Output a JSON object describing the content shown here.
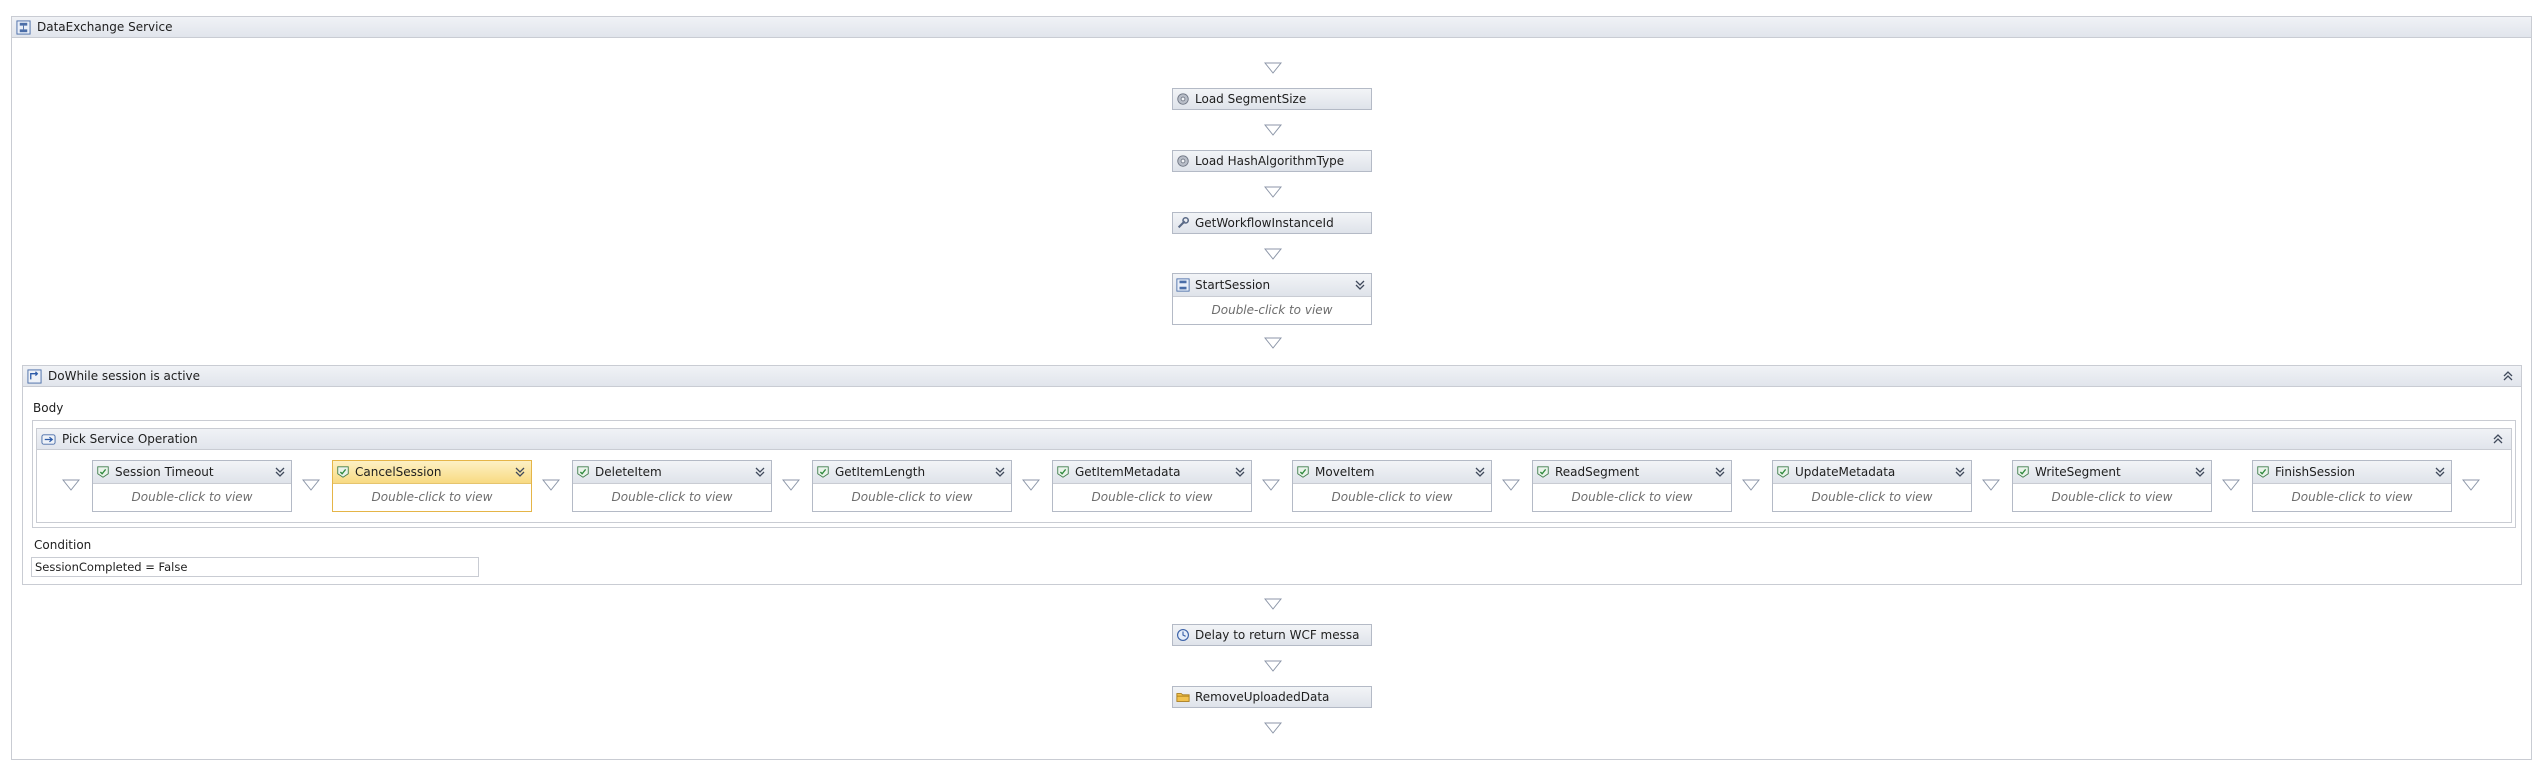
{
  "workflow": {
    "title": "DataExchange Service",
    "top_activities": [
      {
        "label": "Load SegmentSize",
        "icon": "gear-icon"
      },
      {
        "label": "Load HashAlgorithmType",
        "icon": "gear-icon"
      },
      {
        "label": "GetWorkflowInstanceId",
        "icon": "wrench-icon"
      }
    ],
    "start_session": {
      "label": "StartSession",
      "body": "Double-click to view"
    },
    "do_while": {
      "title": "DoWhile session is active",
      "body_label": "Body",
      "pick": {
        "title": "Pick Service Operation",
        "branches": [
          {
            "label": "Session Timeout",
            "body": "Double-click to view"
          },
          {
            "label": "CancelSession",
            "body": "Double-click to view"
          },
          {
            "label": "DeleteItem",
            "body": "Double-click to view"
          },
          {
            "label": "GetItemLength",
            "body": "Double-click to view"
          },
          {
            "label": "GetItemMetadata",
            "body": "Double-click to view"
          },
          {
            "label": "MoveItem",
            "body": "Double-click to view"
          },
          {
            "label": "ReadSegment",
            "body": "Double-click to view"
          },
          {
            "label": "UpdateMetadata",
            "body": "Double-click to view"
          },
          {
            "label": "WriteSegment",
            "body": "Double-click to view"
          },
          {
            "label": "FinishSession",
            "body": "Double-click to view"
          }
        ]
      },
      "condition_label": "Condition",
      "condition_value": "SessionCompleted = False"
    },
    "bottom_activities": [
      {
        "label": "Delay to return WCF messa",
        "icon": "clock-icon"
      },
      {
        "label": "RemoveUploadedData",
        "icon": "folder-icon"
      }
    ]
  },
  "colors": {
    "header_bg": "#e1e5ec",
    "border": "#c9ccd3",
    "selected_bg": "#f8da82",
    "selected_border": "#e5b548"
  }
}
